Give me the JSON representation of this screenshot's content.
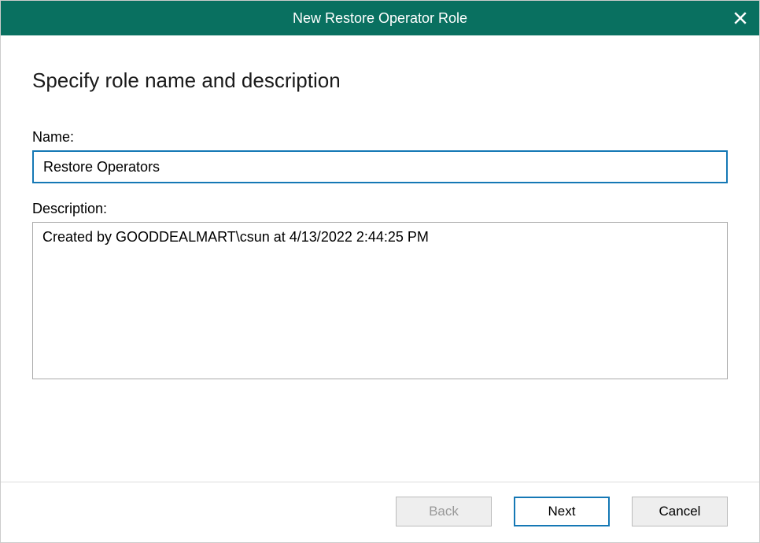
{
  "titlebar": {
    "title": "New Restore Operator Role"
  },
  "page": {
    "heading": "Specify role name and description"
  },
  "fields": {
    "name_label": "Name:",
    "name_value": "Restore Operators",
    "description_label": "Description:",
    "description_value": "Created by GOODDEALMART\\csun at 4/13/2022 2:44:25 PM"
  },
  "buttons": {
    "back": "Back",
    "next": "Next",
    "cancel": "Cancel"
  }
}
